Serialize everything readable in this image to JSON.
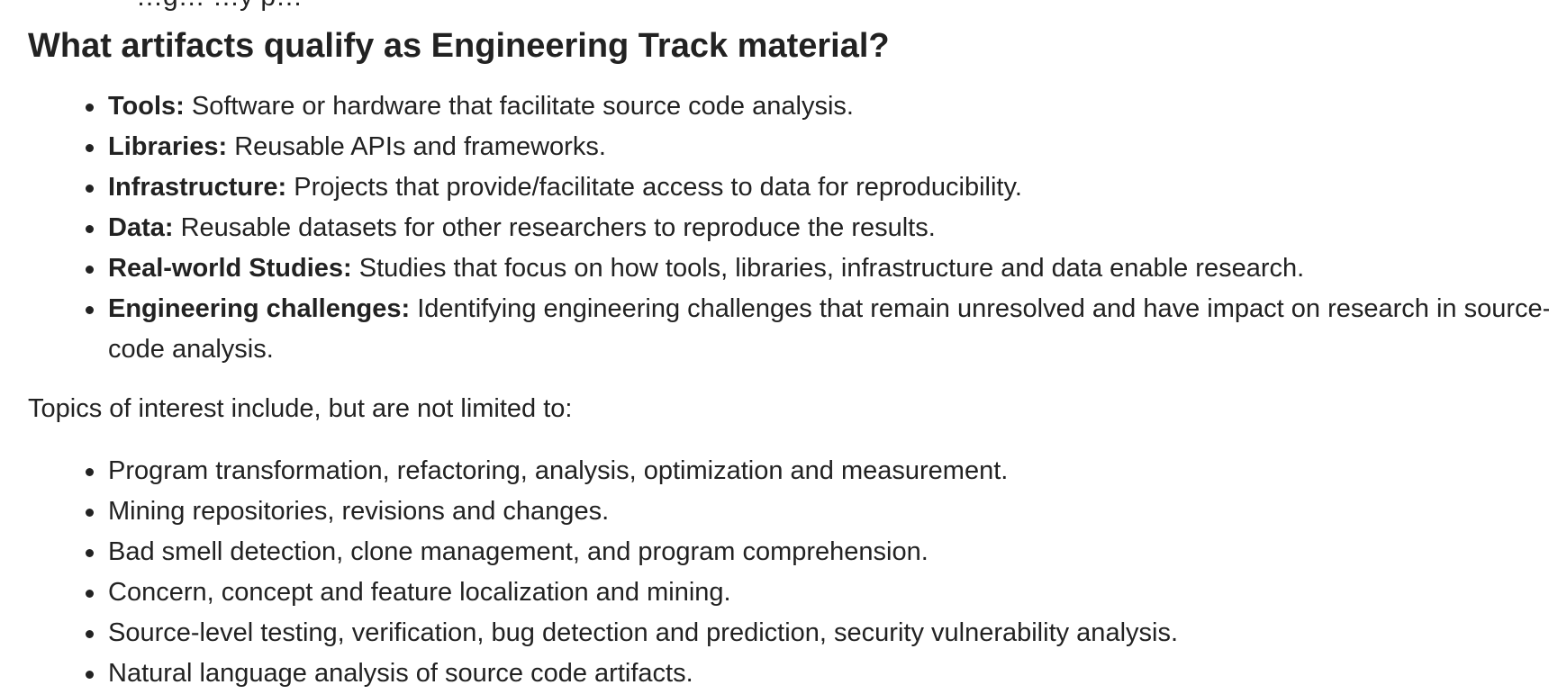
{
  "top_fragment": "…g… …y p…",
  "heading": "What artifacts qualify as Engineering Track material?",
  "artifacts": [
    {
      "label": "Tools:",
      "text": " Software or hardware that facilitate source code analysis."
    },
    {
      "label": "Libraries:",
      "text": " Reusable APIs and frameworks."
    },
    {
      "label": "Infrastructure:",
      "text": " Projects that provide/facilitate access to data for reproducibility."
    },
    {
      "label": "Data:",
      "text": " Reusable datasets for other researchers to reproduce the results."
    },
    {
      "label": "Real-world Studies:",
      "text": " Studies that focus on how tools, libraries, infrastructure and data enable research."
    },
    {
      "label": "Engineering challenges:",
      "text": " Identifying engineering challenges that remain unresolved and have impact on research in source-code analysis."
    }
  ],
  "topics_intro": "Topics of interest include, but are not limited to:",
  "topics": [
    "Program transformation, refactoring, analysis, optimization and measurement.",
    "Mining repositories, revisions and changes.",
    "Bad smell detection, clone management, and program comprehension.",
    "Concern, concept and feature localization and mining.",
    "Source-level testing, verification, bug detection and prediction, security vulnerability analysis.",
    "Natural language analysis of source code artifacts."
  ]
}
